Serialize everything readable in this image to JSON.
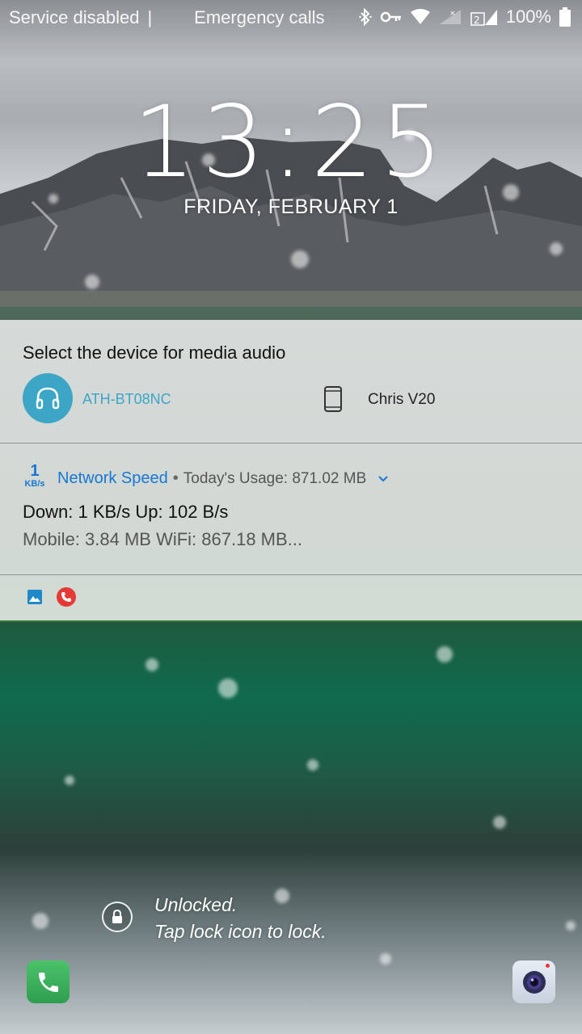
{
  "status_bar": {
    "carrier_text": "Service disabled",
    "separator": "|",
    "emergency_text": "Emergency calls",
    "battery_percent": "100%",
    "icons": [
      "bluetooth-icon",
      "key-icon",
      "wifi-icon",
      "signal-icon",
      "sim-signal-icon",
      "battery-icon"
    ],
    "sim_badge": "2"
  },
  "clock": {
    "hours": "13",
    "colon": ":",
    "minutes": "25"
  },
  "date": "FRIDAY, FEBRUARY 1",
  "audio_card": {
    "title": "Select the device for media audio",
    "devices": [
      {
        "label": "ATH-BT08NC",
        "icon": "headphones-icon",
        "selected": true
      },
      {
        "label": "Chris V20",
        "icon": "phone-icon",
        "selected": false
      }
    ]
  },
  "network_card": {
    "badge_value": "1",
    "badge_unit": "KB/s",
    "app_name": "Network Speed",
    "dot": "•",
    "usage": "Today's Usage: 871.02 MB",
    "line1": "Down: 1 KB/s Up: 102 B/s",
    "line2": "Mobile: 3.84 MB  WiFi: 867.18 MB..."
  },
  "mini_icons": [
    "image-icon",
    "missed-call-icon"
  ],
  "lock": {
    "line1": "Unlocked.",
    "line2": "Tap lock icon to lock."
  },
  "shortcuts": {
    "left": "phone-shortcut-icon",
    "right": "camera-shortcut-icon"
  },
  "colors": {
    "accent_blue": "#1976d2",
    "device_teal": "#3da5c6",
    "call_red": "#e53935",
    "phone_green": "#3bb15b"
  }
}
